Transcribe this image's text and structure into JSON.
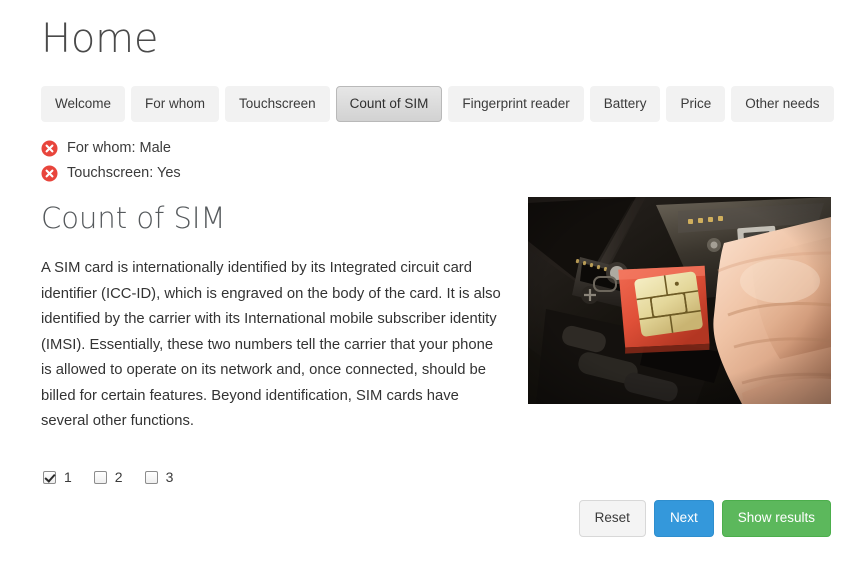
{
  "page": {
    "title": "Home"
  },
  "tabs": [
    {
      "label": "Welcome",
      "active": false
    },
    {
      "label": "For whom",
      "active": false
    },
    {
      "label": "Touchscreen",
      "active": false
    },
    {
      "label": "Count of SIM",
      "active": true
    },
    {
      "label": "Fingerprint reader",
      "active": false
    },
    {
      "label": "Battery",
      "active": false
    },
    {
      "label": "Price",
      "active": false
    },
    {
      "label": "Other needs",
      "active": false
    }
  ],
  "answers": [
    {
      "icon": "remove-answer-icon",
      "text": "For whom: Male"
    },
    {
      "icon": "remove-answer-icon",
      "text": "Touchscreen: Yes"
    }
  ],
  "section": {
    "heading": "Count of SIM",
    "paragraph": "A SIM card is internationally identified by its Integrated circuit card identifier (ICC-ID), which is engraved on the body of the card. It is also identified by the carrier with its International mobile subscriber identity (IMSI). Essentially, these two numbers tell the carrier that your phone is allowed to operate on its network and, once connected, should be billed for certain features. Beyond identification, SIM cards have several other functions.",
    "image_alt": "Hand inserting a red SIM card into the SIM slot of a black mobile phone"
  },
  "options": [
    {
      "label": "1",
      "checked": true
    },
    {
      "label": "2",
      "checked": false
    },
    {
      "label": "3",
      "checked": false
    }
  ],
  "actions": {
    "reset_label": "Reset",
    "next_label": "Next",
    "show_results_label": "Show results"
  },
  "colors": {
    "tab_inactive_bg": "#f2f2f2",
    "tab_active_bg": "#d9d9d9",
    "answer_icon": "#e8453c",
    "primary": "#3498db",
    "success": "#5cb85c",
    "default_btn": "#f4f4f4",
    "text": "#333333",
    "heading": "#55595c"
  }
}
